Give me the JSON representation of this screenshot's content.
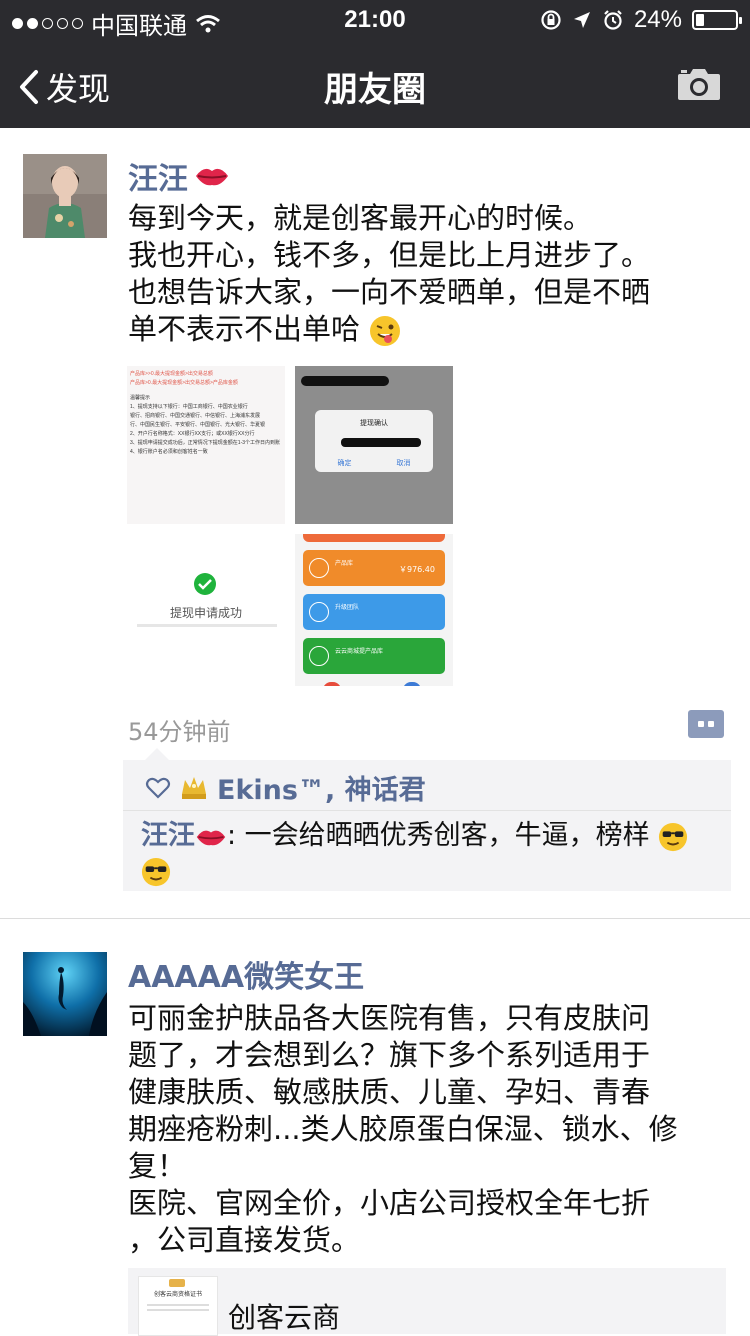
{
  "status": {
    "carrier": "中国联通",
    "time": "21:00",
    "battery": "24%",
    "signal_bars_on": 2,
    "signal_bars_total": 5
  },
  "nav": {
    "back_label": "发现",
    "title": "朋友圈"
  },
  "posts": [
    {
      "author": "汪汪",
      "text_lines": [
        "每到今天，就是创客最开心的时候。",
        "我也开心，钱不多，但是比上月进步了。",
        "也想告诉大家，一向不爱晒单，但是不晒",
        "单不表示不出单哈"
      ],
      "time_ago": "54分钟前",
      "likes": "Ekins™, 神话君",
      "comment": {
        "author": "汪汪",
        "text": ": 一会给晒晒优秀创客，牛逼，榜样"
      },
      "images": [
        {
          "title": "产品库>0.最大提现金额>出交易总额>产品库金额",
          "lines": [
            "产品库>>0.最大提现金额>出交易总额",
            "温馨提示",
            "1、提现支持以下银行：中国工商银行、中国农业银行",
            "银行、招商银行、中国交通银行、中信银行、上海浦东发展",
            "行、中国民生银行、平安银行、中国银行、光大银行、华夏银",
            "2、开户行名称格式：XX银行XX支行；或XX银行XX分行",
            "3、提现申请提交成功后，正常情况下提现金额在1-3个工作日内到账",
            "4、银行账户名必须和创客姓名一致"
          ]
        },
        {
          "dialog_title": "提现确认",
          "dialog_ok": "确定",
          "dialog_cancel": "取消"
        },
        {
          "success_text": "提现申请成功"
        },
        {
          "amount": "￥976.40",
          "items": [
            "产品库",
            "升级团队",
            "云云商城提产品库"
          ]
        }
      ]
    },
    {
      "author": "AAAAA微笑女王",
      "text_lines": [
        "可丽金护肤品各大医院有售，只有皮肤问",
        "题了，才会想到么？旗下多个系列适用于",
        "健康肤质、敏感肤质、儿童、孕妇、青春",
        "期痤疮粉刺...类人胶原蛋白保湿、锁水、修",
        "复！",
        "医院、官网全价，小店公司授权全年七折",
        "，公司直接发货。"
      ],
      "link": {
        "title": "创客云商",
        "thumb_title": "创客云商资格证书"
      }
    }
  ],
  "colors": {
    "nav_bg": "#2b2b2f",
    "name_blue": "#576b95",
    "time_gray": "#999999",
    "panel_bg": "#f3f3f5"
  }
}
